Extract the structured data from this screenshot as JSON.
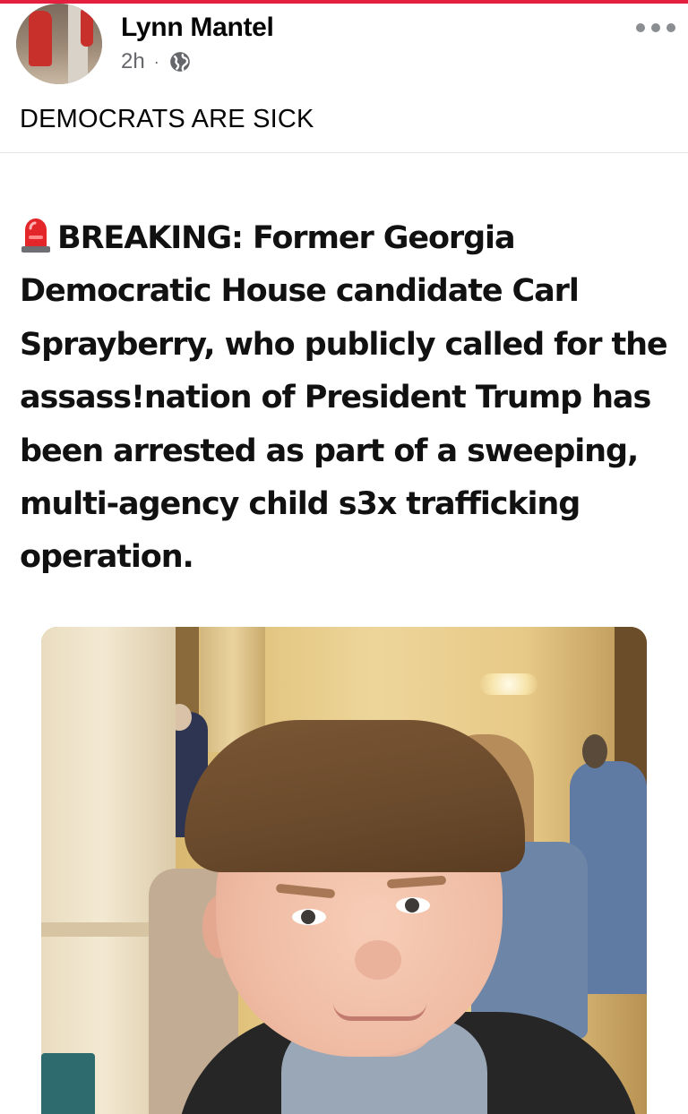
{
  "post": {
    "author": "Lynn Mantel",
    "timestamp": "2h",
    "separator": "·",
    "audience_icon": "globe-icon",
    "menu_icon": "more-options-icon",
    "caption": "DEMOCRATS ARE SICK"
  },
  "shared_image": {
    "alert_icon": "police-siren-icon",
    "headline": "BREAKING: Former Georgia Democratic House candidate Carl Sprayberry, who publicly called for the assass!nation of President Trump has been arrested as part of a sweeping, multi-agency child s3x trafficking operation."
  },
  "colors": {
    "top_accent": "#e41e3f",
    "meta_text": "#65676b",
    "text": "#050505"
  }
}
